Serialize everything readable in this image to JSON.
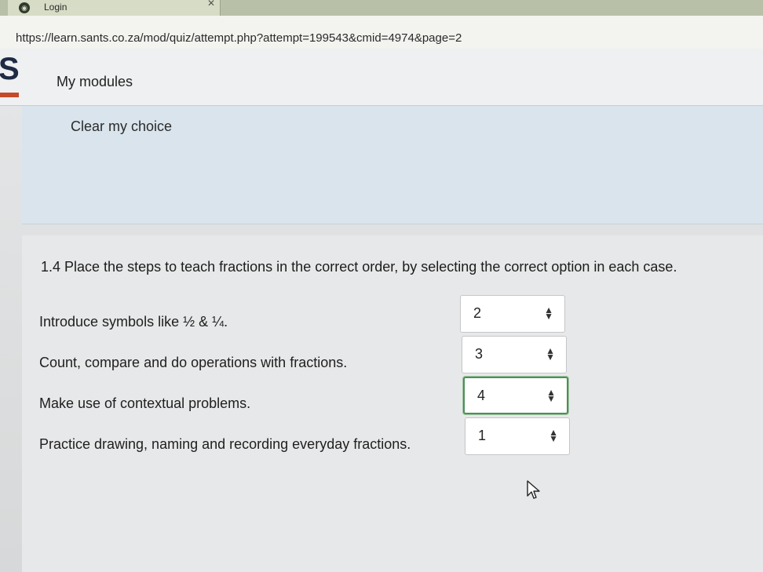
{
  "browser": {
    "tab_title": "Login",
    "url": "https://learn.sants.co.za/mod/quiz/attempt.php?attempt=199543&cmid=4974&page=2"
  },
  "header": {
    "logo_letter": "S",
    "modules_link": "My modules"
  },
  "previous_question": {
    "clear_choice": "Clear my choice"
  },
  "question": {
    "text": "1.4 Place the steps to teach fractions in the correct order, by selecting the correct option in each case.",
    "rows": [
      {
        "label": "Introduce symbols like ½ & ¼.",
        "selected": "2"
      },
      {
        "label": "Count, compare and do operations with fractions.",
        "selected": "3"
      },
      {
        "label": "Make use of contextual problems.",
        "selected": "4"
      },
      {
        "label": "Practice drawing, naming and recording everyday fractions.",
        "selected": "1"
      }
    ]
  },
  "icons": {
    "tab": "globe-icon",
    "select": "updown-arrows-icon",
    "cursor": "mouse-pointer-icon"
  }
}
